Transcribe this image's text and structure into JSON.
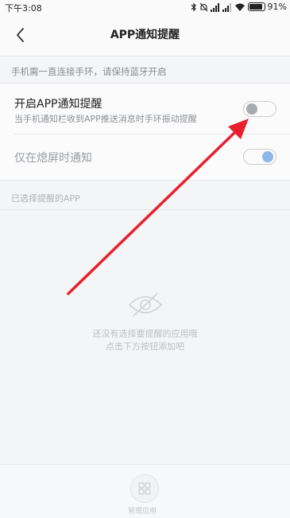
{
  "status_bar": {
    "time": "下午3:08",
    "battery": "91%"
  },
  "header": {
    "title": "APP通知提醒"
  },
  "hint": "手机需一直连接手环，请保持蓝牙开启",
  "settings": {
    "app_notify": {
      "title": "开启APP通知提醒",
      "subtitle": "当手机通知栏收到APP推送消息时手环振动提醒",
      "enabled": false
    },
    "screen_off_only": {
      "title": "仅在熄屏时通知",
      "enabled": true
    }
  },
  "selected_section_label": "已选择提醒的APP",
  "empty_state": {
    "icon": "eye-slash-icon",
    "line1": "还没有选择要提醒的应用哦",
    "line2": "点击下方按钮添加吧"
  },
  "bottom": {
    "manage_label": "管理应用",
    "icon": "grid-icon"
  },
  "colors": {
    "background": "#f4f5f7",
    "toggle_on_knob": "#8fb6e8",
    "toggle_off_knob": "#a8abb0",
    "arrow": "#e8202e"
  }
}
